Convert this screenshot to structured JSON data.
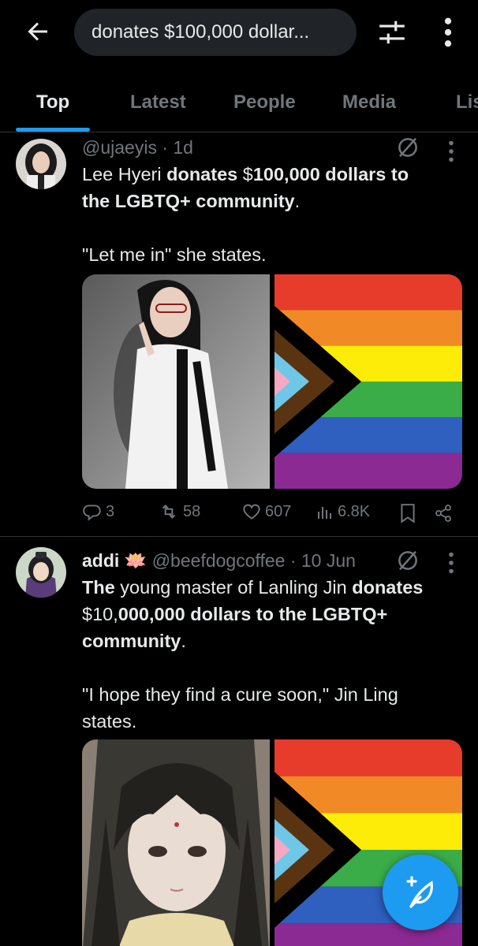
{
  "search": {
    "query": "donates $100,000 dollar..."
  },
  "tabs": [
    {
      "label": "Top",
      "active": true
    },
    {
      "label": "Latest"
    },
    {
      "label": "People"
    },
    {
      "label": "Media"
    },
    {
      "label": "Lis"
    }
  ],
  "tweets": [
    {
      "display_name": "",
      "handle": "@ujaeyis",
      "time": "· 1d",
      "text": {
        "line1_a": "Lee Hyeri ",
        "line1_b": "donates",
        "line1_c": " $",
        "line1_d": "100,000 dollars to",
        "line2_a": "the LGBTQ+ community",
        "line2_b": ".",
        "line3": "\"Let me in\" she states."
      },
      "stats": {
        "replies": "3",
        "reposts": "58",
        "likes": "607",
        "views": "6.8K"
      }
    },
    {
      "display_name": "addi",
      "name_emoji": "🪷",
      "handle": "@beefdogcoffee",
      "time": "· 10 Jun",
      "text": {
        "line1_a": "The",
        "line1_b": " young master of Lanling Jin ",
        "line1_c": "donates",
        "line2_a": "$10,",
        "line2_b": "000,000 dollars to the LGBTQ+",
        "line3_a": "community",
        "line3_b": ".",
        "line4": "\"I hope they find a cure soon,\" Jin Ling",
        "line5": "states."
      }
    }
  ],
  "colors": {
    "accent": "#1d9bf0",
    "background": "#000000",
    "text": "#e7e9ea",
    "muted": "#71767b",
    "flag_stripes": [
      "#e73b2c",
      "#f18a26",
      "#fdec07",
      "#3aad48",
      "#2f5fbf",
      "#8b2a93"
    ],
    "flag_chevrons": [
      "#ffffff",
      "#f6a8c2",
      "#6fc7e8",
      "#5a3411",
      "#000000"
    ]
  },
  "icons": [
    "back-arrow-icon",
    "filter-sliders-icon",
    "more-vertical-icon",
    "grok-icon",
    "reply-icon",
    "repost-icon",
    "like-icon",
    "views-icon",
    "bookmark-icon",
    "share-icon",
    "compose-icon"
  ]
}
